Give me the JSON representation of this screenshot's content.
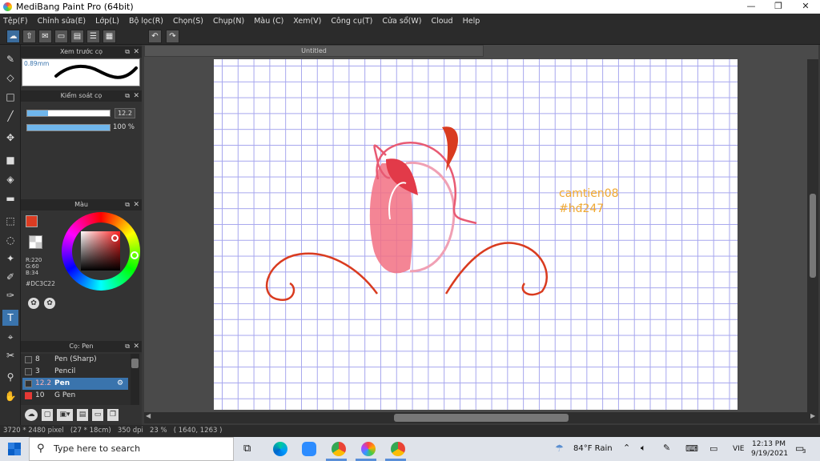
{
  "window": {
    "title": "MediBang Paint Pro (64bit)",
    "minimize": "—",
    "maximize": "❐",
    "close": "✕"
  },
  "menu": [
    "Tệp(F)",
    "Chỉnh sửa(E)",
    "Lớp(L)",
    "Bộ lọc(R)",
    "Chọn(S)",
    "Chụp(N)",
    "Màu (C)",
    "Xem(V)",
    "Công cụ(T)",
    "Cửa sổ(W)",
    "Cloud",
    "Help"
  ],
  "toolbar": {
    "undo": "↶",
    "redo": "↷"
  },
  "panels": {
    "brush_preview": {
      "title": "Xem trước cọ",
      "size": "0.89mm"
    },
    "brush_control": {
      "title": "Kiểm soát cọ",
      "size_value": "12.2",
      "size_fraction": 0.25,
      "opacity_value": "100 %",
      "opacity_fraction": 1.0
    },
    "color": {
      "title": "Màu",
      "r": "R:220",
      "g": "G:60",
      "b": "B:34",
      "hex": "#DC3C22",
      "primary": "#DC3C22"
    },
    "brush_list": {
      "title": "Cọ: Pen",
      "items": [
        {
          "size": "8",
          "name": "Pen (Sharp)",
          "color": "#333333",
          "selected": false
        },
        {
          "size": "3",
          "name": "Pencil",
          "color": "#333333",
          "selected": false
        },
        {
          "size": "12.2",
          "name": "Pen",
          "color": "#333333",
          "selected": true
        },
        {
          "size": "10",
          "name": "G Pen",
          "color": "#e53935",
          "selected": false
        }
      ]
    }
  },
  "document": {
    "tab": "Untitled",
    "watermark_line1": "camtien08",
    "watermark_line2": "#hđ247"
  },
  "status": {
    "text": "3720 * 2480 pixel   (27 * 18cm)   350 dpi   23 %   ( 1640, 1263 )"
  },
  "taskbar": {
    "search_placeholder": "Type here to search",
    "weather": "84°F  Rain",
    "language": "VIE",
    "time": "12:13 PM",
    "date": "9/19/2021",
    "notifications": "3"
  }
}
